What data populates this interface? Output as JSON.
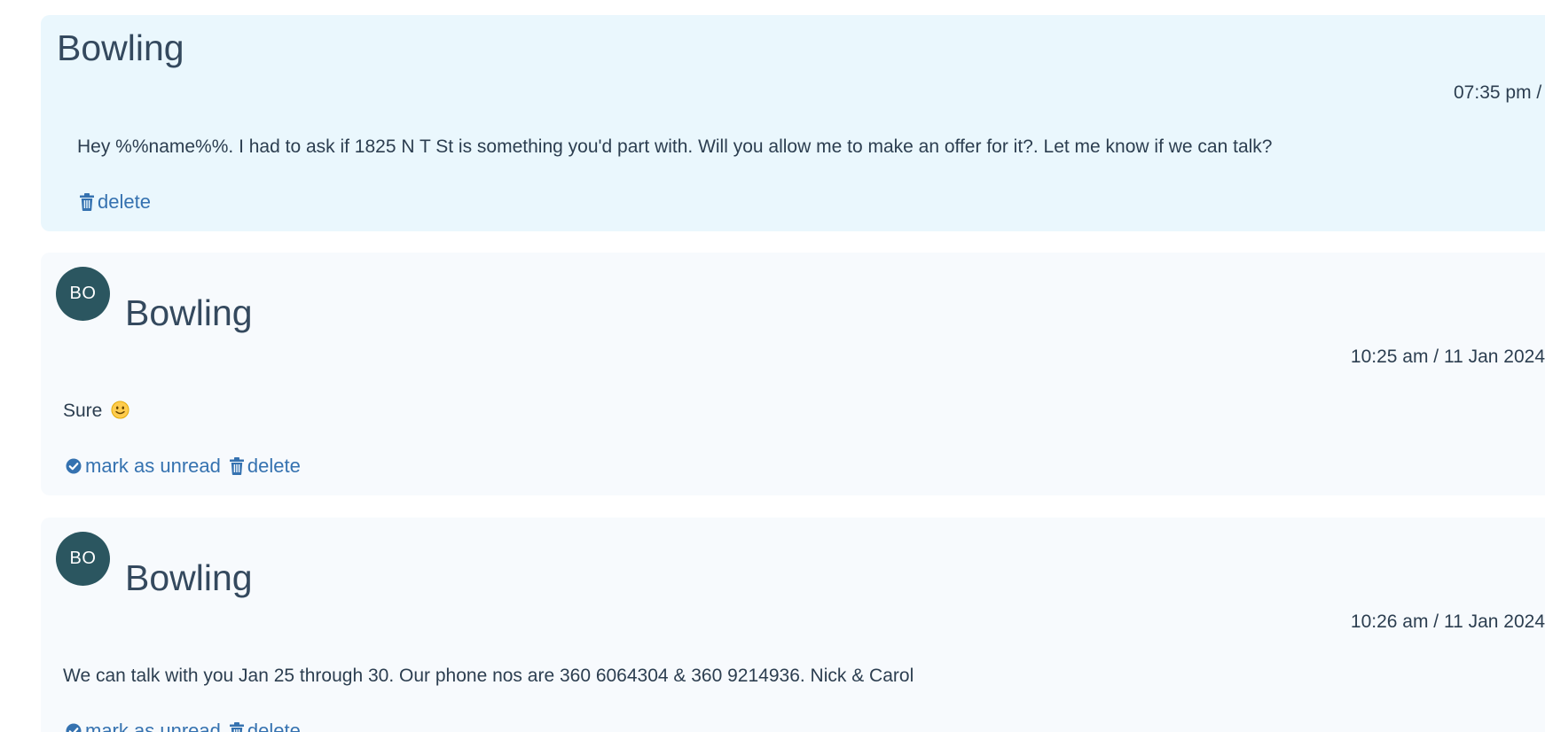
{
  "messages": [
    {
      "sender": "Bowling",
      "timestamp": "07:35 pm /",
      "body": "Hey %%name%%. I had to ask if 1825 N T St is something you'd part with. Will you allow me to make an offer for it?. Let me know if we can talk?",
      "actions": {
        "delete": "delete"
      }
    },
    {
      "sender": "Bowling",
      "avatar": "BO",
      "timestamp": "10:25 am / 11 Jan 2024",
      "body": "Sure",
      "body_emoji": "slightly-smiling-face-icon",
      "actions": {
        "mark_unread": "mark as unread",
        "delete": "delete"
      }
    },
    {
      "sender": "Bowling",
      "avatar": "BO",
      "timestamp": "10:26 am / 11 Jan 2024",
      "body": "We can talk with you Jan 25 through 30. Our phone nos are 360 6064304 & 360 9214936. Nick & Carol",
      "actions": {
        "mark_unread": "mark as unread",
        "delete": "delete"
      }
    }
  ],
  "colors": {
    "outgoing_bg": "#eaf7fd",
    "incoming_bg": "#f7fafd",
    "avatar_bg": "#2b5660",
    "link": "#3572b0",
    "text": "#2c3e50"
  }
}
